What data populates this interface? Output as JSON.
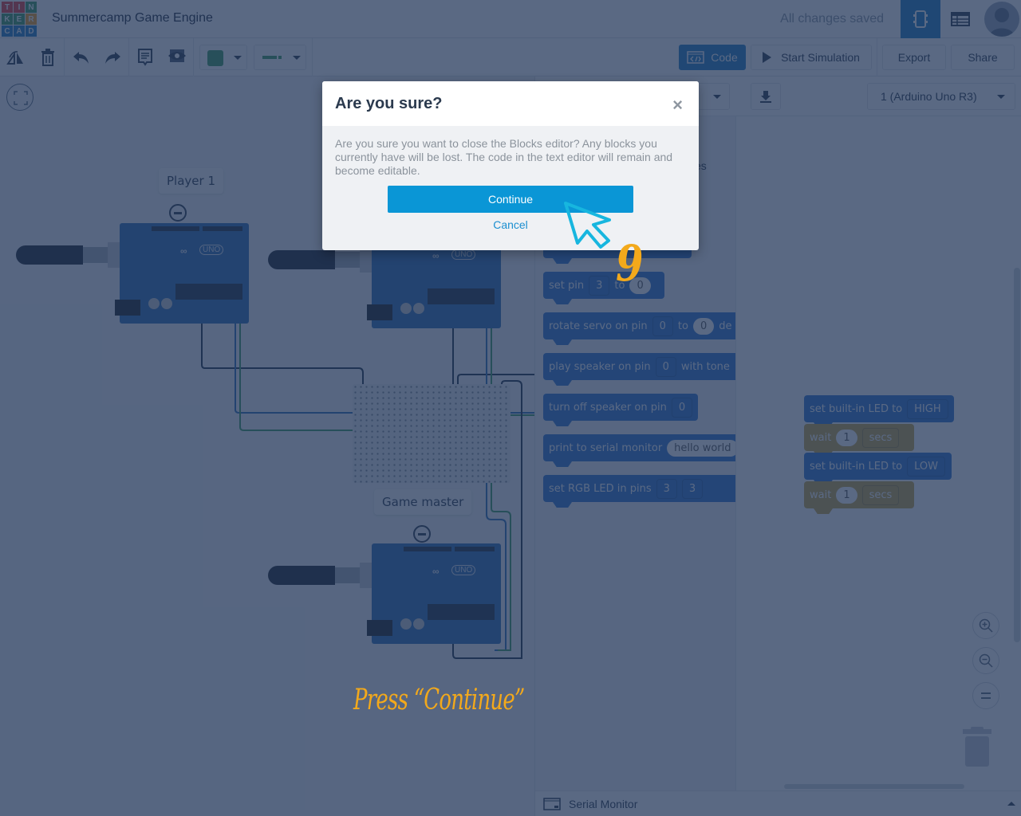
{
  "app": {
    "logo_letters": [
      "T",
      "I",
      "N",
      "K",
      "E",
      "R",
      "C",
      "A",
      "D"
    ],
    "logo_colors": [
      "#e33c3c",
      "#e33c3c",
      "#3a9a60",
      "#3a9a60",
      "#3a9a60",
      "#f3a020",
      "#1f7dc4",
      "#1f7dc4",
      "#1f7dc4"
    ],
    "project_title": "Summercamp Game Engine",
    "save_status": "All changes saved"
  },
  "header_icons": {
    "circuit_view": "circuit-view-icon",
    "component_list": "component-list-icon",
    "user": "user-avatar-icon"
  },
  "toolbar": {
    "rotate_icon": "rotate-icon",
    "delete_icon": "trash-icon",
    "undo_icon": "undo-icon",
    "redo_icon": "redo-icon",
    "notes_icon": "notes-icon",
    "visibility_icon": "eye-icon",
    "color_value": "#3a9a60",
    "code_label": "Code",
    "start_simulation_label": "Start Simulation",
    "export_label": "Export",
    "share_label": "Share"
  },
  "canvas": {
    "labels": [
      "Player 1",
      "Game master"
    ]
  },
  "code_panel": {
    "device_select": "1 (Arduino Uno R3)",
    "palette_partial_text": "es",
    "palette_blocks": [
      {
        "text": "set pin",
        "fields": [
          "3",
          "to",
          "0"
        ]
      },
      {
        "text": "rotate servo on pin",
        "fields": [
          "0",
          "to",
          "0",
          "de"
        ]
      },
      {
        "text": "play speaker on pin",
        "fields": [
          "0",
          "with tone"
        ]
      },
      {
        "text": "turn off speaker on pin",
        "fields": [
          "0"
        ]
      },
      {
        "text": "print to serial monitor",
        "fields": [
          "hello world"
        ]
      },
      {
        "text": "set RGB LED in pins",
        "fields": [
          "3",
          "3"
        ]
      }
    ],
    "workspace_blocks": [
      {
        "text": "set built-in LED to",
        "value": "HIGH"
      },
      {
        "text": "wait",
        "value": "1",
        "unit": "secs"
      },
      {
        "text": "set built-in LED to",
        "value": "LOW"
      },
      {
        "text": "wait",
        "value": "1",
        "unit": "secs"
      }
    ],
    "serial_monitor_label": "Serial Monitor"
  },
  "dialog": {
    "title": "Are you sure?",
    "message": "Are you sure you want to close the Blocks editor? Any blocks you currently have will be lost. The code in the text editor will remain and become editable.",
    "continue_label": "Continue",
    "cancel_label": "Cancel"
  },
  "annotation": {
    "step_number": "9",
    "instruction": "Press “Continue”",
    "color": "#f3a91b"
  }
}
